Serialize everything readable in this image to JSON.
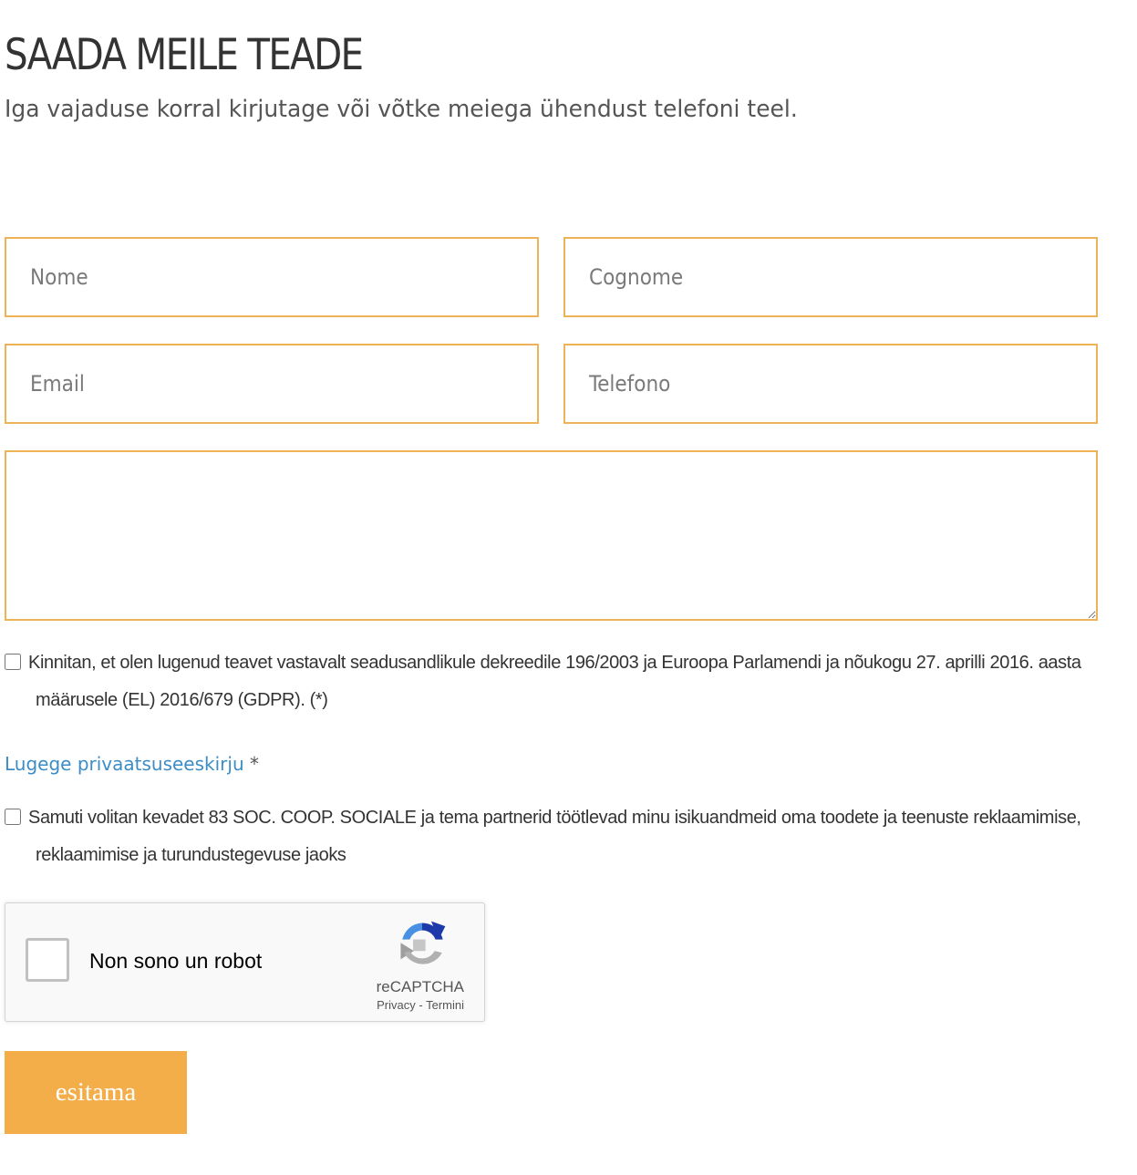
{
  "header": {
    "title": "SAADA MEILE TEADE",
    "subtitle": "Iga vajaduse korral kirjutage või võtke meiega ühendust telefoni teel."
  },
  "form": {
    "nome_placeholder": "Nome",
    "cognome_placeholder": "Cognome",
    "email_placeholder": "Email",
    "telefono_placeholder": "Telefono",
    "message_placeholder": "",
    "consent1_line1": "Kinnitan, et olen lugenud teavet vastavalt seadusandlikule dekreedile 196/2003 ja Euroopa Parlamendi ja nõukogu 27. aprilli 2016. aasta",
    "consent1_line2": "määrusele (EL) 2016/679 (GDPR). (*)",
    "privacy_link": "Lugege privaatsuseeskirju",
    "privacy_required": "*",
    "consent2_line1": "Samuti volitan kevadet 83 SOC. COOP. SOCIALE ja tema partnerid töötlevad minu isikuandmeid oma toodete ja teenuste reklaamimise,",
    "consent2_line2": "reklaamimise ja turundustegevuse jaoks",
    "submit_label": "esitama"
  },
  "recaptcha": {
    "label": "Non sono un robot",
    "brand": "reCAPTCHA",
    "privacy": "Privacy",
    "separator": " - ",
    "terms": "Termini"
  },
  "colors": {
    "field_border": "#eeb257",
    "button_bg": "#f4ae49",
    "link": "#3c8dc5"
  }
}
